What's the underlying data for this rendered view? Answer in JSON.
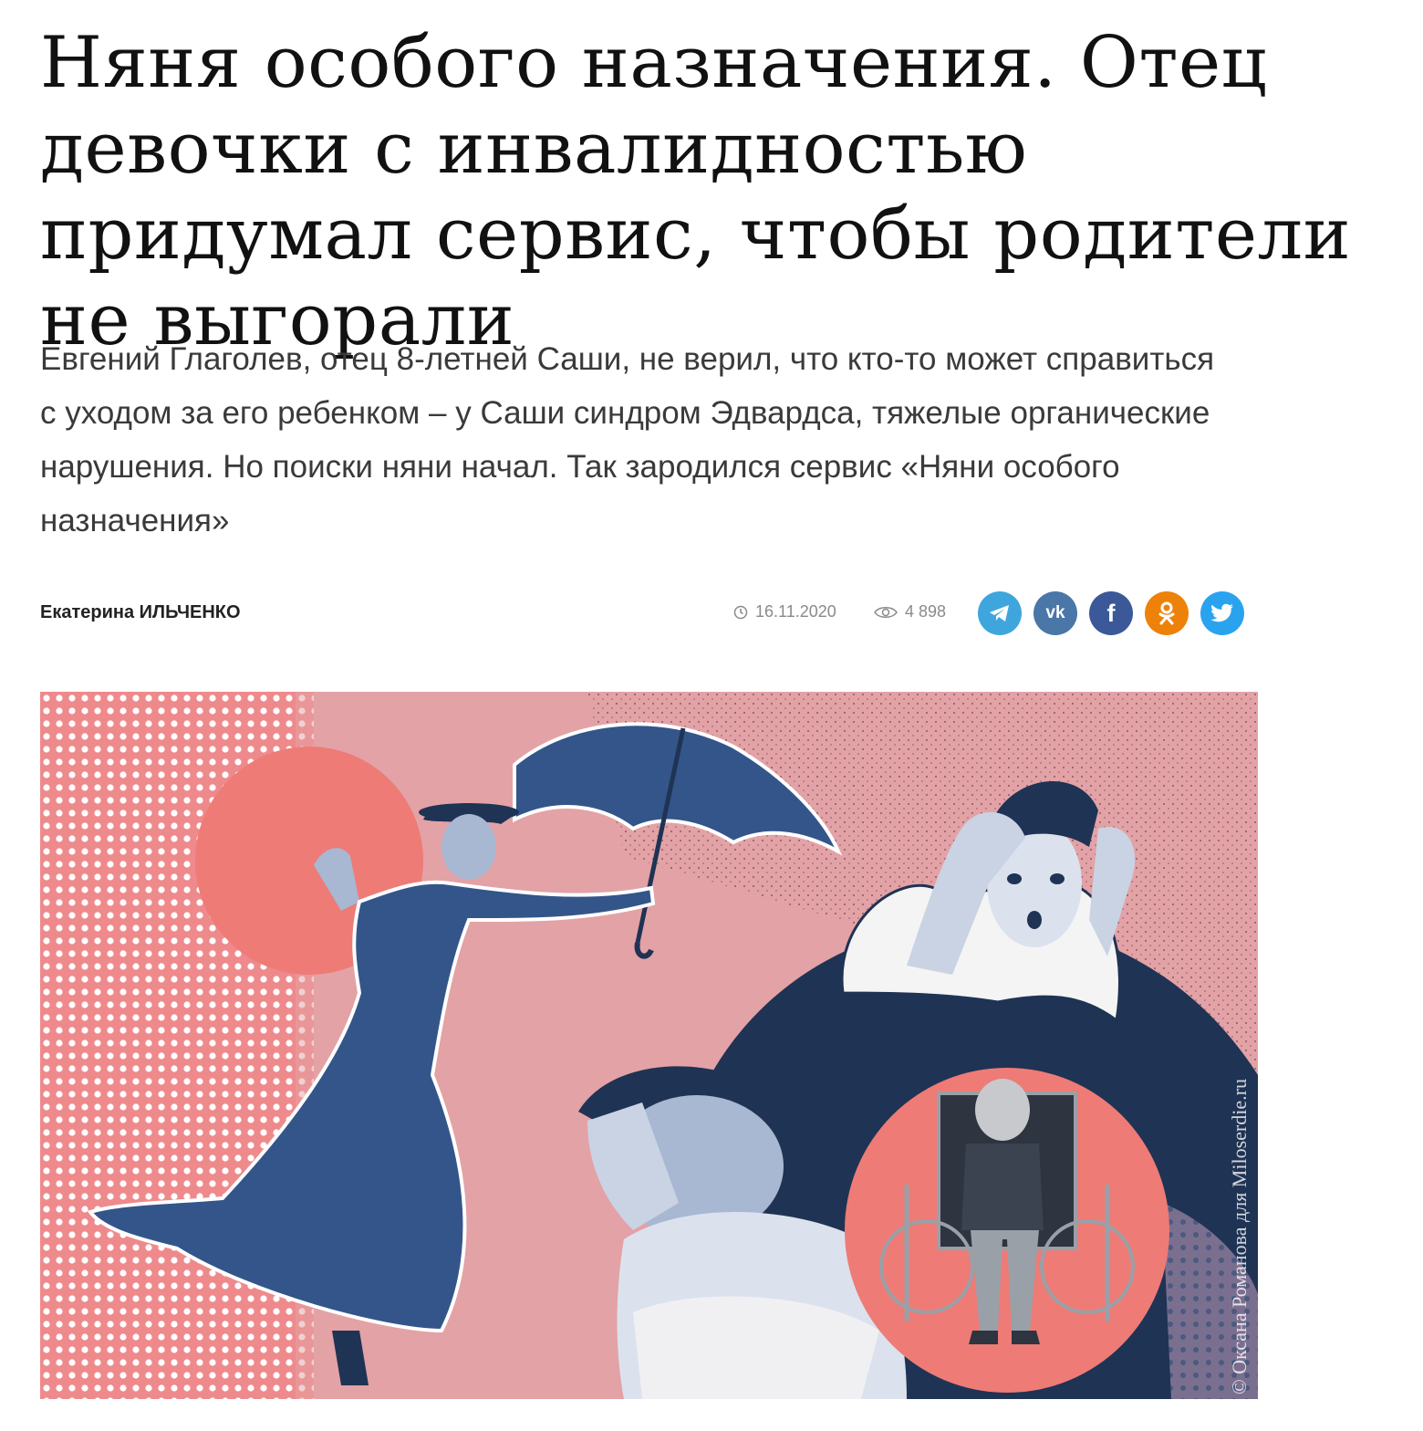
{
  "article": {
    "title": "Няня особого назначения. Отец девочки с инвалидностью придумал сервис, чтобы родители не выгорали",
    "lead": "Евгений Глаголев, отец 8-летней Саши, не верил, что кто-то может справиться с уходом за его ребенком – у Саши синдром Эдвардса, тяжелые органические нарушения. Но поиски няни начал. Так зародился сервис «Няни особого назначения»"
  },
  "meta": {
    "author": "Екатерина ИЛЬЧЕНКО",
    "date": "16.11.2020",
    "views": "4 898",
    "date_icon": "clock-icon",
    "views_icon": "eye-icon"
  },
  "share": [
    {
      "network": "telegram",
      "icon": "telegram-icon",
      "color": "#3ea6dd"
    },
    {
      "network": "vk",
      "icon": "vk-icon",
      "color": "#4a76a8",
      "glyph": "vk"
    },
    {
      "network": "facebook",
      "icon": "facebook-icon",
      "color": "#3b5998",
      "glyph": "f"
    },
    {
      "network": "odnoklassniki",
      "icon": "odnoklassniki-icon",
      "color": "#ee8208"
    },
    {
      "network": "twitter",
      "icon": "twitter-icon",
      "color": "#2aa3ef"
    }
  ],
  "hero": {
    "credit": "© Оксана Романова для Miloserdie.ru",
    "colors": {
      "background": "#e3a2a6",
      "coral": "#ee7b76",
      "navy": "#1f3354",
      "figure_blue": "#34558a"
    }
  }
}
